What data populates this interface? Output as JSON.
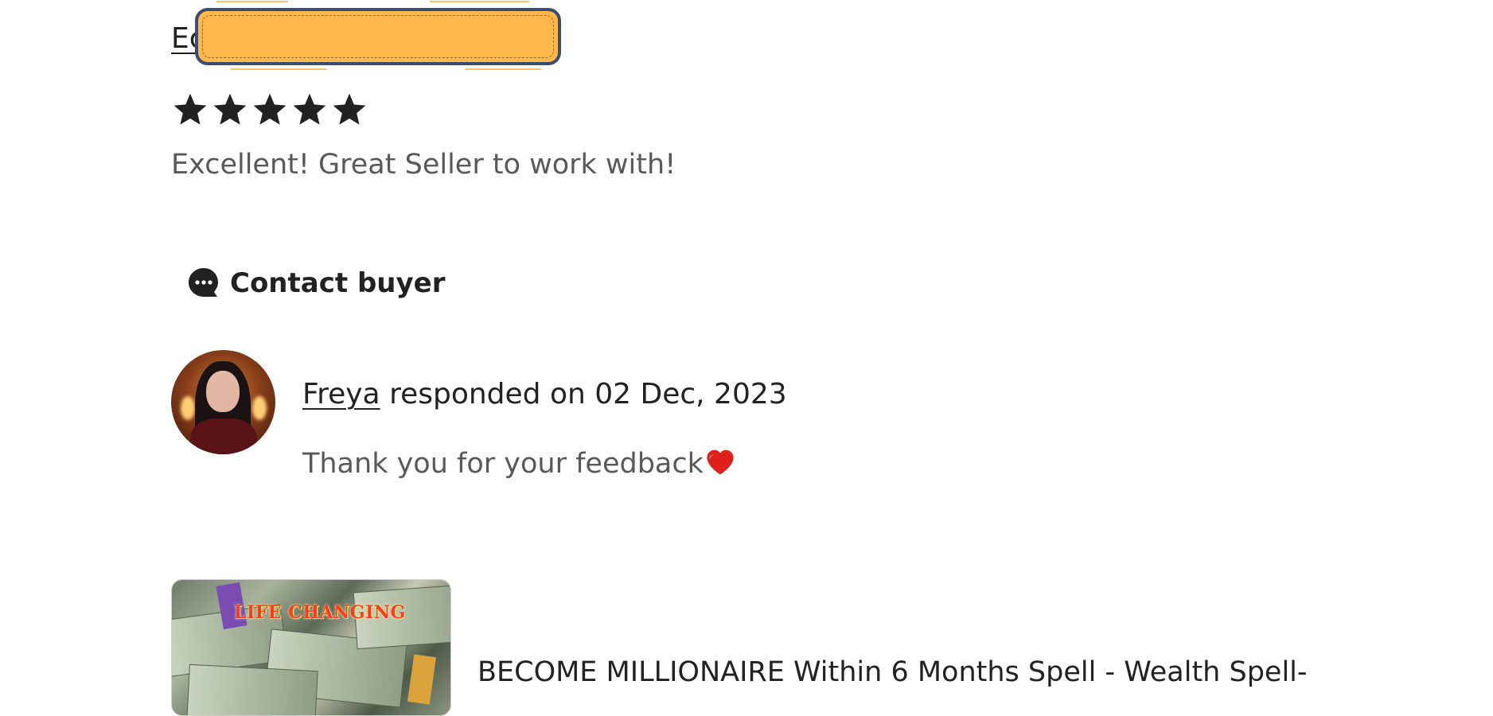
{
  "review": {
    "reviewer_name_visible": "Ec",
    "rating": 5,
    "rating_max": 5,
    "text": "Excellent! Great Seller to work with!"
  },
  "contact": {
    "label": "Contact buyer",
    "icon": "chat-bubble-icon"
  },
  "response": {
    "seller_name": "Freya",
    "date_text": " responded on 02 Dec, 2023",
    "message": "Thank you for your feedback",
    "emoji_icon": "heart-icon"
  },
  "listing": {
    "thumbnail_caption": "LIFE CHANGING",
    "title": "BECOME MILLIONAIRE Within 6 Months Spell - Wealth Spell-"
  },
  "colors": {
    "primary_text": "#222222",
    "secondary_text": "#595959",
    "redaction_fill": "#ffb84d",
    "redaction_border": "#3b4e6b",
    "heart": "#e0211b"
  }
}
